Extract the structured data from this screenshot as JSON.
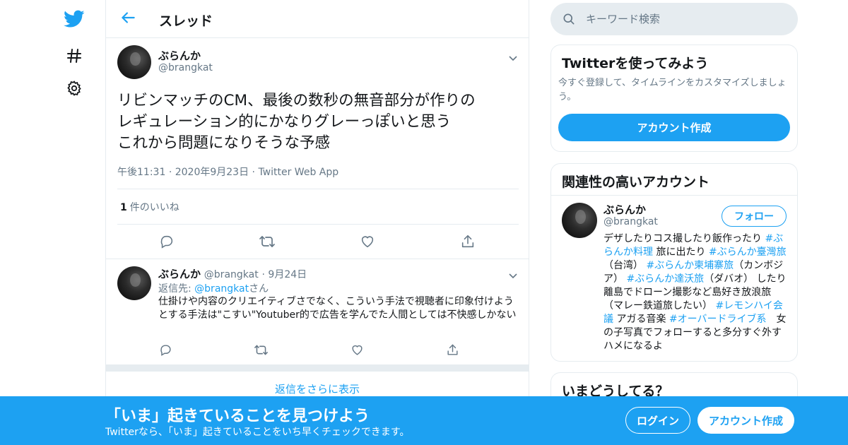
{
  "colors": {
    "accent": "#1da1f2",
    "text": "#14171a",
    "muted": "#657786",
    "border": "#e6ecf0"
  },
  "nav": {
    "icons": [
      "twitter-bird-icon",
      "hashtag-icon",
      "settings-gear-icon"
    ]
  },
  "header": {
    "title": "スレッド"
  },
  "focal_tweet": {
    "name": "ぶらんか",
    "handle": "@brangkat",
    "text": "リビンマッチのCM、最後の数秒の無音部分が作りの\nレギュレーション的にかなりグレーっぽいと思う\nこれから問題になりそうな予感",
    "time": "午後11:31",
    "date": "2020年9月23日",
    "source": "Twitter Web App",
    "like_count": "1",
    "like_label": "件のいいね"
  },
  "reply": {
    "name": "ぶらんか",
    "handle": "@brangkat",
    "date": "9月24日",
    "reply_to_prefix": "返信先: ",
    "reply_to_handle": "@brangkat",
    "reply_to_suffix": "さん",
    "text": "仕掛けや内容のクリエイティブさでなく、こういう手法で視聴者に印象付けようとする手法は\"こすい\"Youtuber的で広告を学んでた人間としては不快感しかない"
  },
  "more_replies": "返信をさらに表示",
  "search": {
    "placeholder": "キーワード検索"
  },
  "signup_card": {
    "title": "Twitterを使ってみよう",
    "description": "今すぐ登録して、タイムラインをカスタマイズしましょう。",
    "button": "アカウント作成"
  },
  "related_card": {
    "title": "関連性の高いアカウント",
    "name": "ぶらんか",
    "handle": "@brangkat",
    "follow": "フォロー",
    "bio": [
      {
        "t": "デザしたりコス撮したり飯作ったり ",
        "tag": false
      },
      {
        "t": "#ぶらんか料理",
        "tag": true
      },
      {
        "t": " 旅に出たり ",
        "tag": false
      },
      {
        "t": "#ぶらんか臺灣旅",
        "tag": true
      },
      {
        "t": "（台湾） ",
        "tag": false
      },
      {
        "t": "#ぶらんか柬埔寨旅",
        "tag": true
      },
      {
        "t": "（カンボジア） ",
        "tag": false
      },
      {
        "t": "#ぶらんか達沃旅",
        "tag": true
      },
      {
        "t": "（ダバオ） したり離島でドローン撮影など島好き放浪旅（マレー鉄道旅したい） ",
        "tag": false
      },
      {
        "t": "#レモンハイ会議",
        "tag": true
      },
      {
        "t": " アガる音楽 ",
        "tag": false
      },
      {
        "t": "#オーバードライブ系",
        "tag": true
      },
      {
        "t": "　女の子写真でフォローすると多分すぐ外すハメになるよ",
        "tag": false
      }
    ]
  },
  "trends_card": {
    "title": "いまどうしてる？"
  },
  "banner": {
    "title": "「いま」起きていることを見つけよう",
    "subtitle": "Twitterなら、「いま」起きていることをいち早くチェックできます。",
    "login": "ログイン",
    "signup": "アカウント作成"
  }
}
